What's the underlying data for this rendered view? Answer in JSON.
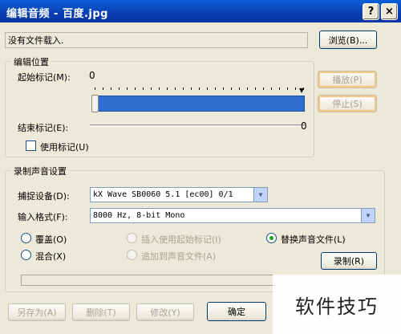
{
  "window": {
    "title": "编辑音频 - 百度.jpg",
    "help_glyph": "?",
    "close_glyph": "×"
  },
  "file": {
    "value": "没有文件载入.",
    "browse_label": "浏览(B)..."
  },
  "edit_position": {
    "legend": "编辑位置",
    "start_label": "起始标记(M):",
    "start_value_marker": "0",
    "end_label": "结束标记(E):",
    "end_value_marker": "0",
    "play_label": "播放(P)",
    "stop_label": "停止(S)",
    "use_marks_label": "使用标记(U)"
  },
  "record_settings": {
    "legend": "录制声音设置",
    "capture_label": "捕捉设备(D):",
    "capture_value": "kX Wave SB0060 5.1 [ec00] 0/1",
    "format_label": "输入格式(F):",
    "format_value": "8000 Hz, 8-bit Mono",
    "radio_overwrite": "覆盖(O)",
    "radio_mix": "混合(X)",
    "radio_insert_start": "插入使用起始标记(I)",
    "radio_append": "追加到声音文件(A)",
    "radio_replace": "替换声音文件(L)",
    "record_label": "录制(R)"
  },
  "bottom_buttons": {
    "save_as": "另存为(A)",
    "delete": "删除(T)",
    "modify": "修改(Y)",
    "ok": "确定"
  },
  "watermark": {
    "text": "软件技巧"
  }
}
